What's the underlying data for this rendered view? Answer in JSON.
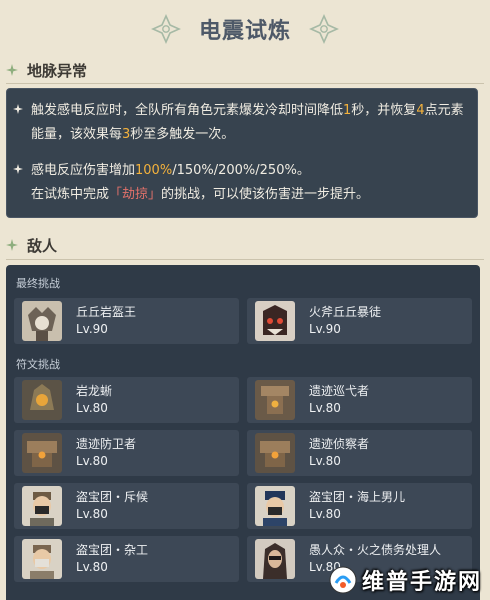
{
  "header": {
    "title": "电震试炼"
  },
  "ley_line": {
    "section_title": "地脉异常",
    "item1": {
      "text_a": "触发感电反应时，全队所有角色元素爆发冷却时间降低",
      "num_a": "1",
      "text_b": "秒，并恢复",
      "num_b": "4",
      "text_c": "点元素能量，该效果每",
      "num_c": "3",
      "text_d": "秒至多触发一次。"
    },
    "item2": {
      "text_a": "感电反应伤害增加",
      "pct_first": "100%",
      "pct_rest": "/150%/200%/250%。",
      "text_b": "在试炼中完成",
      "challenge": "「劫掠」",
      "text_c": "的挑战，可以使该伤害进一步提升。"
    }
  },
  "enemies": {
    "section_title": "敌人",
    "final_label": "最终挑战",
    "rune_label": "符文挑战",
    "final": [
      {
        "name": "丘丘岩盔王",
        "level": "Lv.90",
        "portrait": "hilichurl-king-portrait"
      },
      {
        "name": "火斧丘丘暴徒",
        "level": "Lv.90",
        "portrait": "axe-mitachurl-portrait"
      }
    ],
    "rune": [
      {
        "name": "岩龙蜥",
        "level": "Lv.80",
        "portrait": "geovishap-portrait"
      },
      {
        "name": "遗迹巡弋者",
        "level": "Lv.80",
        "portrait": "ruin-cruiser-portrait"
      },
      {
        "name": "遗迹防卫者",
        "level": "Lv.80",
        "portrait": "ruin-defender-portrait"
      },
      {
        "name": "遗迹侦察者",
        "level": "Lv.80",
        "portrait": "ruin-scout-portrait"
      },
      {
        "name": "盗宝团・斥候",
        "level": "Lv.80",
        "portrait": "treasure-hoarder-scout-portrait"
      },
      {
        "name": "盗宝团・海上男儿",
        "level": "Lv.80",
        "portrait": "treasure-hoarder-seaman-portrait"
      },
      {
        "name": "盗宝团・杂工",
        "level": "Lv.80",
        "portrait": "treasure-hoarder-handyman-portrait"
      },
      {
        "name": "愚人众・火之债务处理人",
        "level": "Lv.80",
        "portrait": "fatui-debt-collector-portrait"
      }
    ]
  },
  "watermark": {
    "text": "维普手游网"
  },
  "colors": {
    "background": "#ece5d3",
    "panel": "#37434f",
    "highlight_gold": "#f4b23c",
    "highlight_red": "#e2716a",
    "section_accent": "#8eae7e"
  }
}
